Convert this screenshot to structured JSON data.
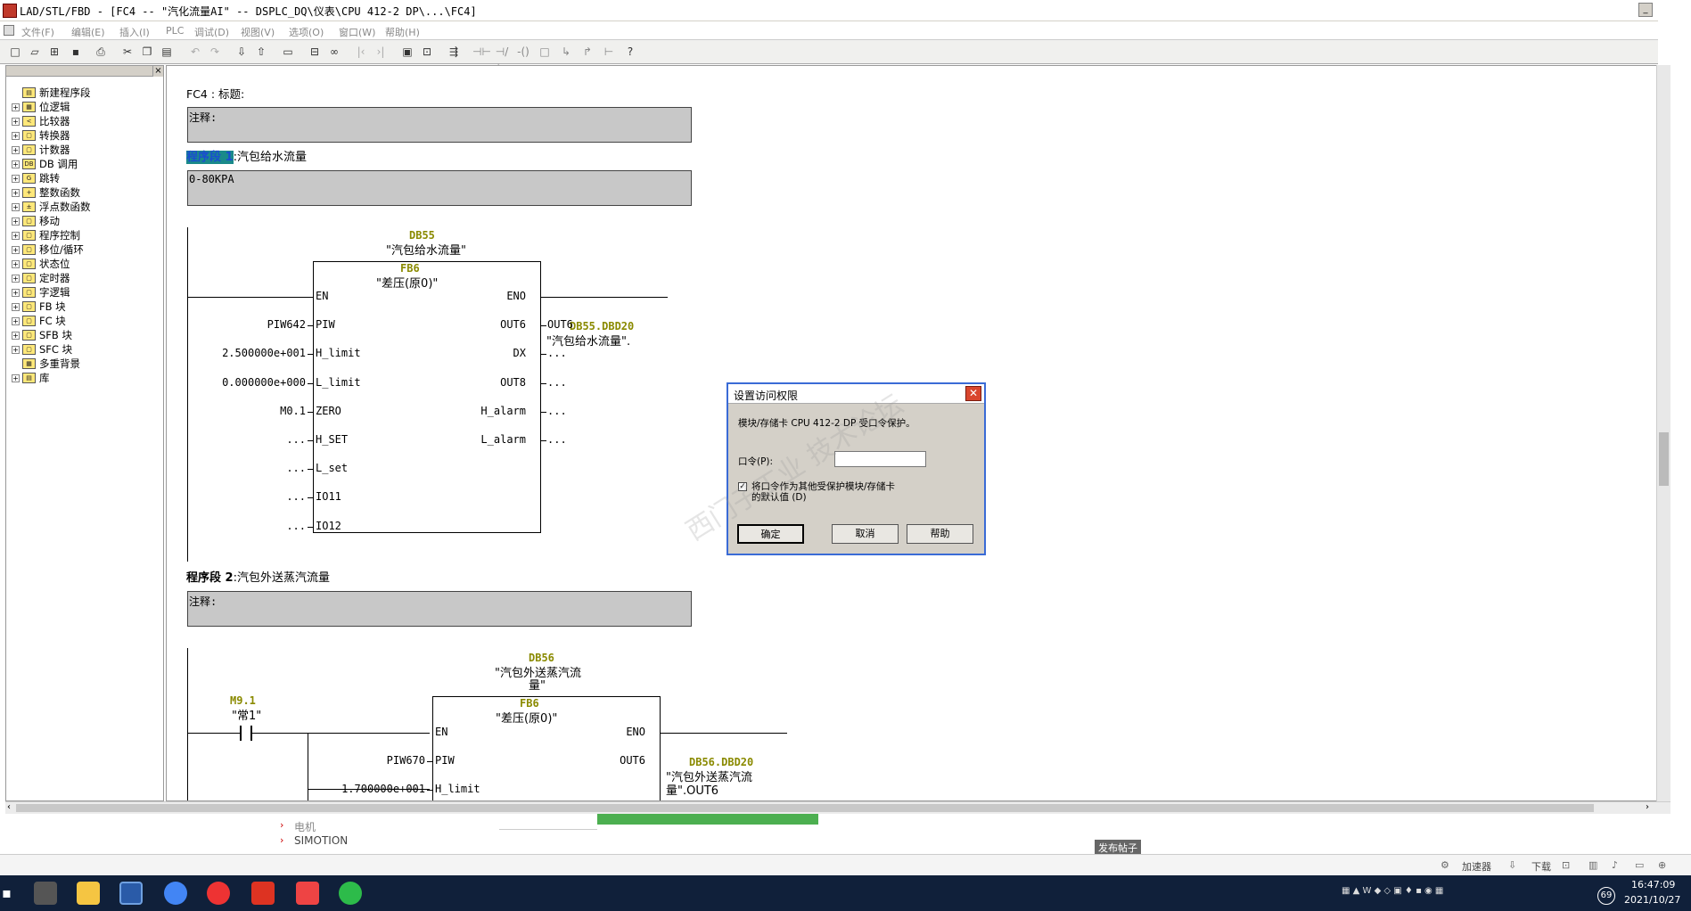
{
  "window": {
    "title": "LAD/STL/FBD  - [FC4 -- \"汽化流量AI\" -- DSPLC_DQ\\仪表\\CPU 412-2 DP\\...\\FC4]",
    "minimize": "_"
  },
  "menu": [
    "文件(F)",
    "编辑(E)",
    "插入(I)",
    "PLC",
    "调试(D)",
    "视图(V)",
    "选项(O)",
    "窗口(W)",
    "帮助(H)"
  ],
  "tree": [
    {
      "label": "新建程序段",
      "expandable": false
    },
    {
      "label": "位逻辑",
      "expandable": true
    },
    {
      "label": "比较器",
      "expandable": true
    },
    {
      "label": "转换器",
      "expandable": true
    },
    {
      "label": "计数器",
      "expandable": true
    },
    {
      "label": "DB 调用",
      "expandable": true
    },
    {
      "label": "跳转",
      "expandable": true
    },
    {
      "label": "整数函数",
      "expandable": true
    },
    {
      "label": "浮点数函数",
      "expandable": true
    },
    {
      "label": "移动",
      "expandable": true
    },
    {
      "label": "程序控制",
      "expandable": true
    },
    {
      "label": "移位/循环",
      "expandable": true
    },
    {
      "label": "状态位",
      "expandable": true
    },
    {
      "label": "定时器",
      "expandable": true
    },
    {
      "label": "字逻辑",
      "expandable": true
    },
    {
      "label": "FB 块",
      "expandable": true
    },
    {
      "label": "FC 块",
      "expandable": true
    },
    {
      "label": "SFB 块",
      "expandable": true
    },
    {
      "label": "SFC 块",
      "expandable": true
    },
    {
      "label": "多重背景",
      "expandable": false
    },
    {
      "label": "库",
      "expandable": true
    }
  ],
  "editor": {
    "block_title": "FC4 : 标题:",
    "comment_label": "注释:",
    "network1": {
      "label_hl": "程序段 1",
      "label_rest": ":汽包给水流量",
      "comment": "0-80KPA",
      "db": "DB55",
      "db_sym": "\"汽包给水流量\"",
      "fb": "FB6",
      "fb_sym": "\"差压(原0)\"",
      "pins_left": [
        "EN",
        "PIW",
        "H_limit",
        "L_limit",
        "ZERO",
        "H_SET",
        "L_set",
        "IO11",
        "IO12"
      ],
      "vals_left": [
        "",
        "PIW642",
        "2.500000e+001",
        "0.000000e+000",
        "M0.1",
        "...",
        "...",
        "...",
        "..."
      ],
      "pins_right": [
        "ENO",
        "OUT6",
        "DX",
        "OUT8",
        "H_alarm",
        "L_alarm"
      ],
      "vals_right": [
        "",
        "OUT6",
        "...",
        "...",
        "...",
        "..."
      ],
      "out_addr": "DB55.DBD20",
      "out_sym": "\"汽包给水流量\"."
    },
    "network2": {
      "label": "程序段  2",
      "label_rest": ":汽包外送蒸汽流量",
      "contact_addr": "M9.1",
      "contact_sym": "\"常1\"",
      "db": "DB56",
      "db_sym_1": "\"汽包外送蒸汽流",
      "db_sym_2": "量\"",
      "fb": "FB6",
      "fb_sym": "\"差压(原0)\"",
      "pins_left": [
        "EN",
        "PIW",
        "H_limit"
      ],
      "vals_left": [
        "",
        "PIW670",
        "1.700000e+001"
      ],
      "pins_right": [
        "ENO",
        "OUT6"
      ],
      "out_addr": "DB56.DBD20",
      "out_sym_1": "\"汽包外送蒸汽流",
      "out_sym_2": "量\".OUT6"
    }
  },
  "dialog": {
    "title": "设置访问权限",
    "message": "模块/存储卡 CPU 412-2 DP 受口令保护。",
    "password_label": "口令(P):",
    "password_value": "",
    "checkbox_line1": "将口令作为其他受保护模块/存储卡",
    "checkbox_line2": "的默认值 (D)",
    "checkbox_checked": true,
    "ok": "确定",
    "cancel": "取消",
    "help": "帮助",
    "watermark": "西门子工业 技术论坛"
  },
  "browser": {
    "item_elec": "电机",
    "item_simotion": "SIMOTION",
    "post_button": "发布帖子",
    "accelerator": "加速器",
    "download": "下载"
  },
  "taskbar": {
    "time": "16:47:09",
    "date": "2021/10/27",
    "badge": "69"
  },
  "colors": {
    "taskbar": "#10203a",
    "dialog_border": "#3a6bd6",
    "segment_highlight": "#1a8a8a",
    "db_text": "#8a8a00"
  }
}
